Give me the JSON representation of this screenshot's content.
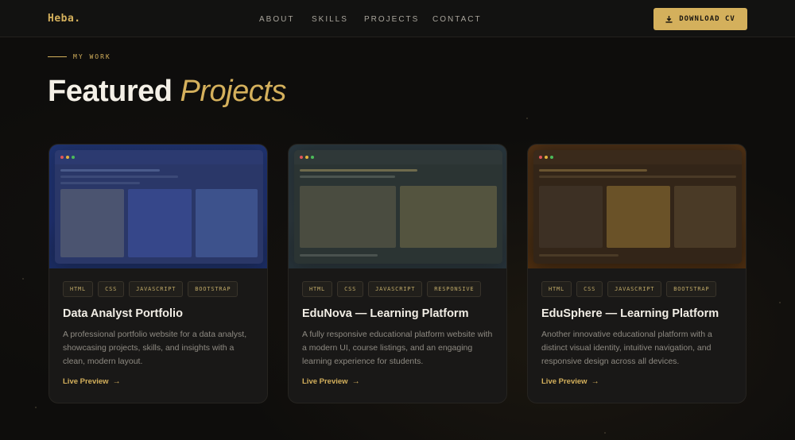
{
  "nav": {
    "logo": "Heba.",
    "links": [
      "ABOUT",
      "SKILLS",
      "PROJECTS",
      "CONTACT"
    ],
    "cv_button": "DOWNLOAD CV"
  },
  "section": {
    "eyebrow": "MY WORK",
    "title_main": "Featured",
    "title_accent": "Projects"
  },
  "projects": [
    {
      "name": "Data Analyst Portfolio",
      "tags": [
        "HTML",
        "CSS",
        "JAVASCRIPT",
        "BOOTSTRAP"
      ],
      "description": "A professional portfolio website for a data analyst, showcasing projects, skills, and insights with a clean, modern layout.",
      "link": "Live Preview"
    },
    {
      "name": "EduNova — Learning Platform",
      "tags": [
        "HTML",
        "CSS",
        "JAVASCRIPT",
        "RESPONSIVE"
      ],
      "description": "A fully responsive educational platform website with a modern UI, course listings, and an engaging learning experience for students.",
      "link": "Live Preview"
    },
    {
      "name": "EduSphere — Learning Platform",
      "tags": [
        "HTML",
        "CSS",
        "JAVASCRIPT",
        "BOOTSTRAP"
      ],
      "description": "Another innovative educational platform with a distinct visual identity, intuitive navigation, and responsive design across all devices.",
      "link": "Live Preview"
    }
  ],
  "colors": {
    "accent": "#d4b05c",
    "background": "#0e0d0c",
    "card": "#191817"
  },
  "icons": {
    "cv_button": "download-icon",
    "live_link": "arrow-right-icon"
  }
}
